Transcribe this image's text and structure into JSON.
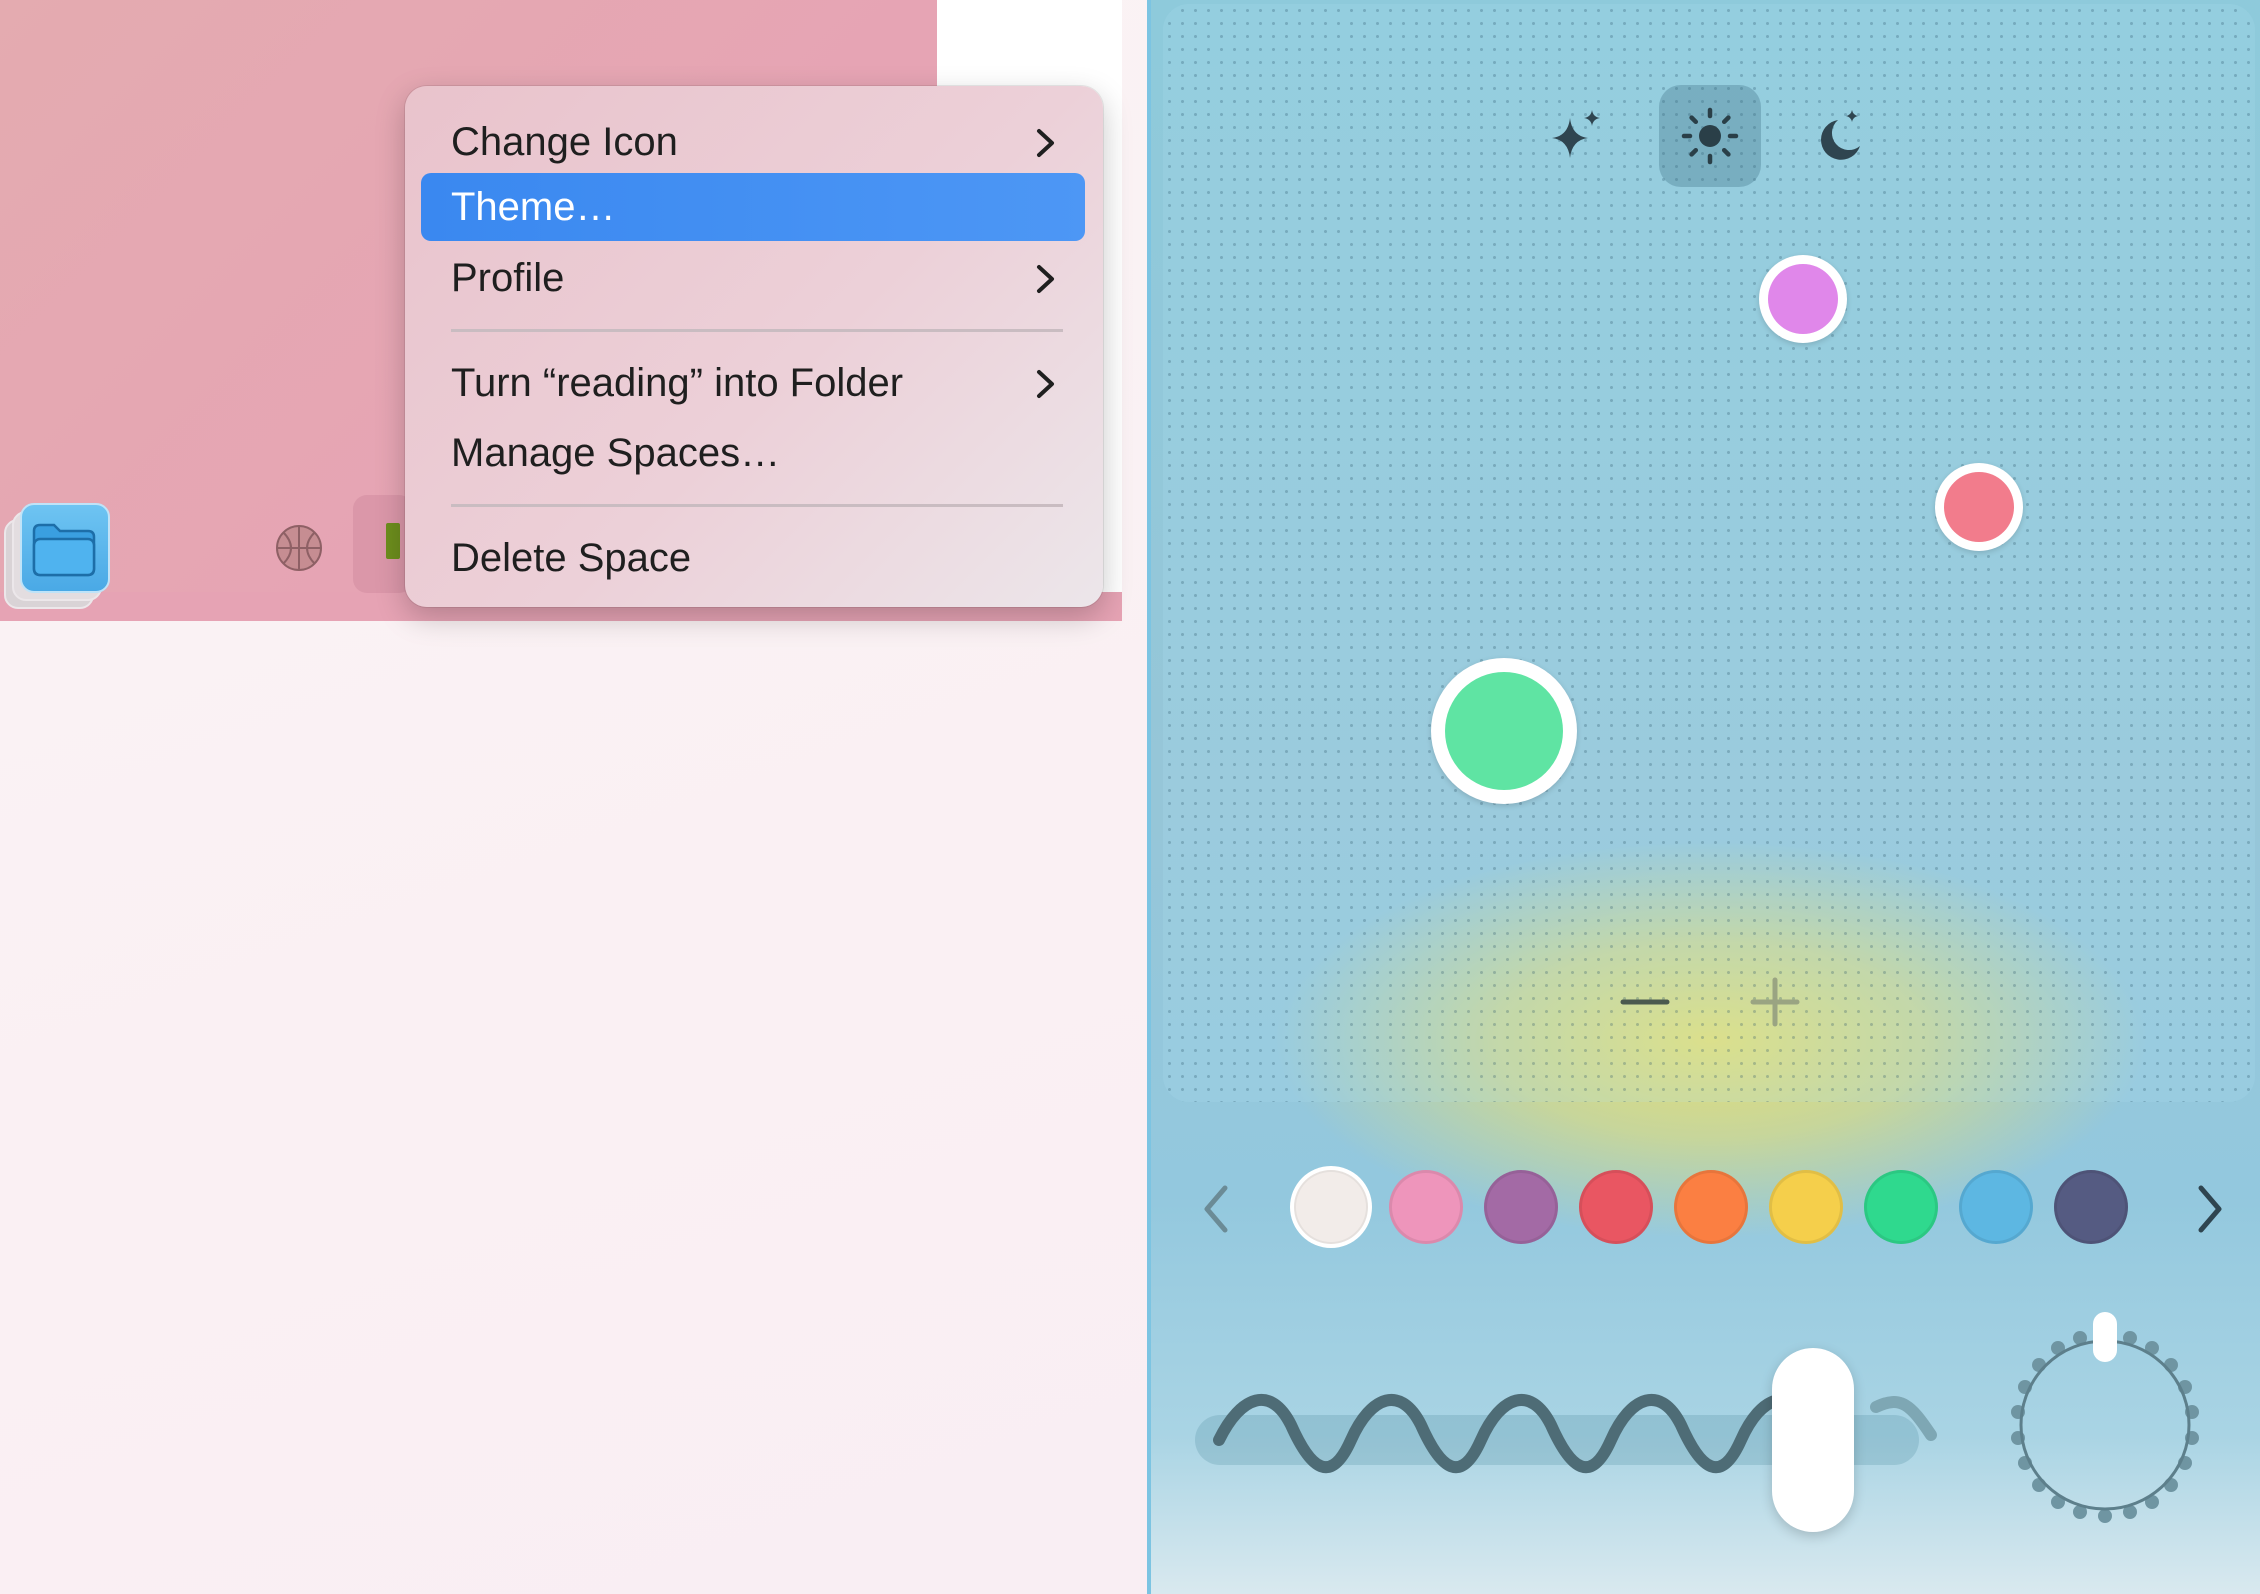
{
  "context_menu": {
    "items": [
      {
        "label": "Change Icon",
        "submenu": true
      },
      {
        "label": "Theme…",
        "submenu": false,
        "highlighted": true
      },
      {
        "label": "Profile",
        "submenu": true
      },
      {
        "label": "Turn “reading” into Folder",
        "submenu": true
      },
      {
        "label": "Manage Spaces…",
        "submenu": false
      },
      {
        "label": "Delete Space",
        "submenu": false
      }
    ]
  },
  "space_bar": {
    "icons": [
      "folder-icon",
      "basketball-icon",
      "book-icon"
    ]
  },
  "theme_picker": {
    "modes": [
      "sparkle-icon",
      "sun-icon",
      "moon-icon"
    ],
    "selected_mode": "sun-icon",
    "gradient_colors": [
      "#e087ea",
      "#f27c8c",
      "#5fe4a3"
    ],
    "zoom_controls": [
      "minus-icon",
      "plus-icon"
    ],
    "swatches": [
      {
        "name": "white",
        "color": "#f2ece9"
      },
      {
        "name": "pink",
        "color": "#ee95bb"
      },
      {
        "name": "purple",
        "color": "#a36aa5"
      },
      {
        "name": "red",
        "color": "#e95662"
      },
      {
        "name": "orange",
        "color": "#fb7f42"
      },
      {
        "name": "yellow",
        "color": "#f5cf4b"
      },
      {
        "name": "green",
        "color": "#2fd98e"
      },
      {
        "name": "blue",
        "color": "#5db7e2"
      },
      {
        "name": "navy",
        "color": "#555b82"
      }
    ],
    "selected_swatch": "white",
    "texture_level": 0.83,
    "colors": {
      "highlight": "#3a88f0",
      "panel_bg": "#93c8de",
      "glow": "#e9e170"
    }
  }
}
